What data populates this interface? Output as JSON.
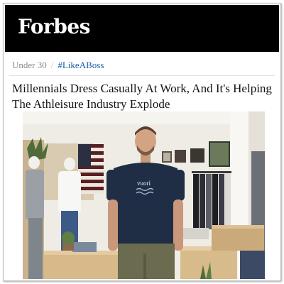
{
  "masthead": {
    "logo_text": "Forbes",
    "background": "#000000"
  },
  "breadcrumb": {
    "section": "Under 30",
    "separator": "/",
    "tag": "#LikeABoss",
    "tag_color": "#1b5fa6"
  },
  "article": {
    "headline": "Millennials Dress Casually At Work, And It's Helping The Athleisure Industry Explode"
  },
  "photo": {
    "shirt_brand": "vuori"
  }
}
